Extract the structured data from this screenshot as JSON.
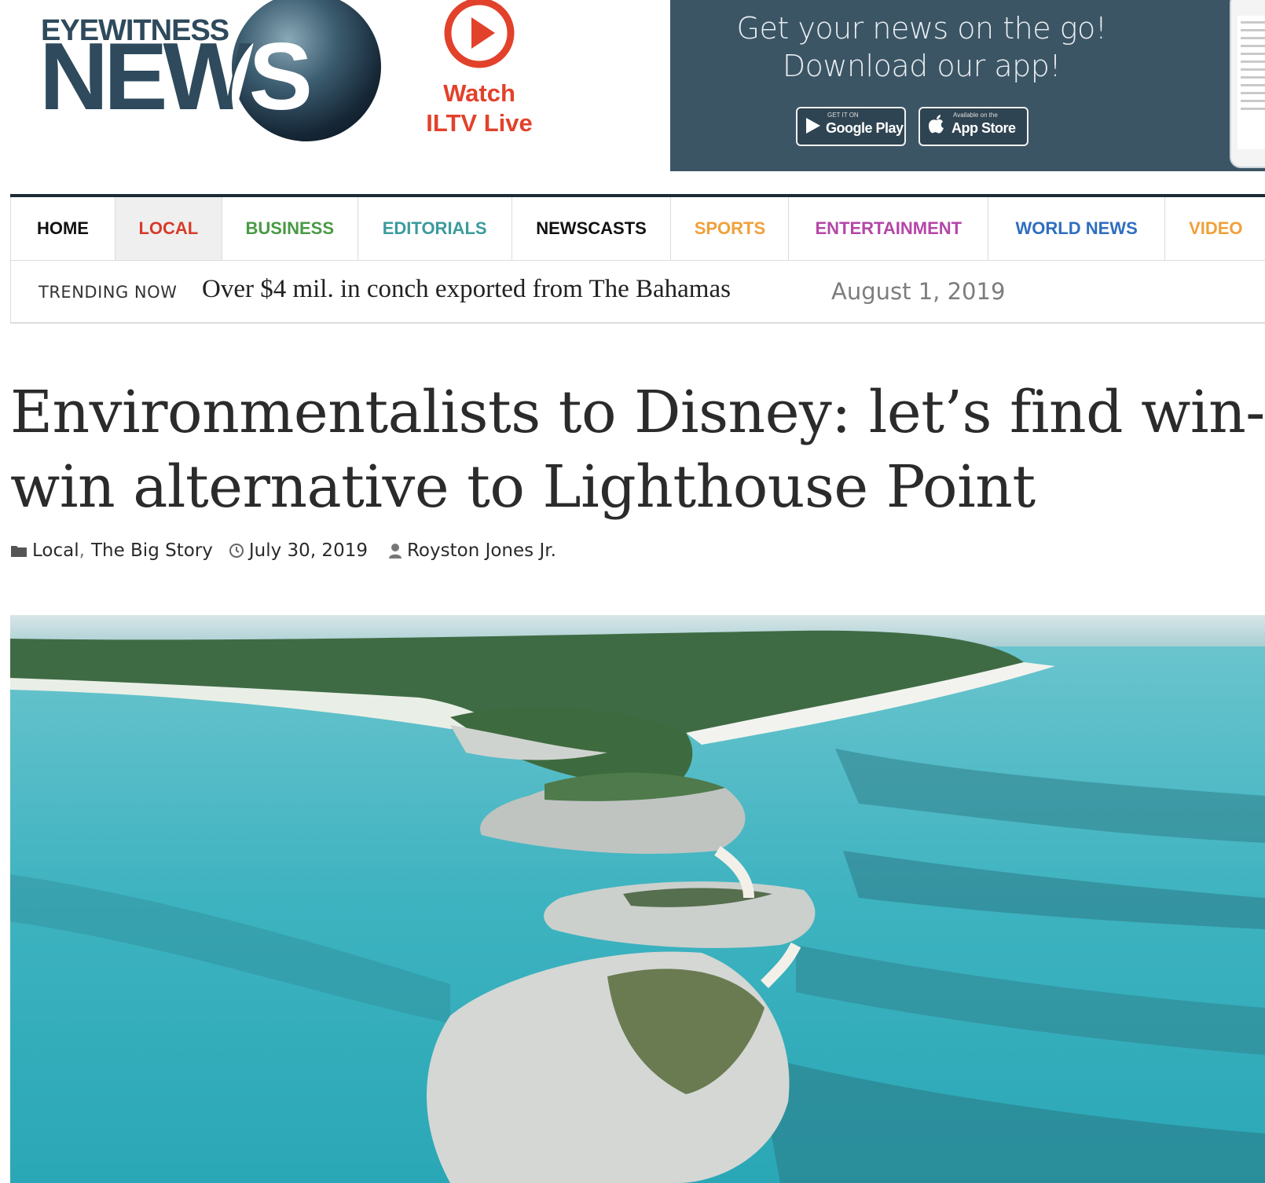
{
  "logo": {
    "top_text": "EYEWITNESS",
    "main_text": "NEWS"
  },
  "watch": {
    "label": "Watch\nILTV Live",
    "color": "#e2412b"
  },
  "ad": {
    "line1": "Get your news on the go!",
    "line2": "Download our app!",
    "google_play": {
      "small": "GET IT ON",
      "name": "Google Play"
    },
    "app_store": {
      "small": "Available on the",
      "name": "App Store"
    }
  },
  "nav": {
    "items": [
      {
        "label": "HOME",
        "color": "#111111",
        "active": false
      },
      {
        "label": "LOCAL",
        "color": "#d63b2a",
        "active": true
      },
      {
        "label": "BUSINESS",
        "color": "#4a9a45",
        "active": false
      },
      {
        "label": "EDITORIALS",
        "color": "#3b9b9c",
        "active": false
      },
      {
        "label": "NEWSCASTS",
        "color": "#111111",
        "active": false
      },
      {
        "label": "SPORTS",
        "color": "#f0a03a",
        "active": false
      },
      {
        "label": "ENTERTAINMENT",
        "color": "#b546a8",
        "active": false
      },
      {
        "label": "WORLD NEWS",
        "color": "#2f6ec0",
        "active": false
      },
      {
        "label": "VIDEO",
        "color": "#f0a03a",
        "active": false
      }
    ]
  },
  "trending": {
    "label": "TRENDING NOW",
    "headline": "Over $4 mil. in conch exported from The Bahamas",
    "date": "August 1, 2019"
  },
  "article": {
    "title": "Environmentalists to Disney: let’s find win-win alternative to Lighthouse Point",
    "categories": [
      "Local",
      "The Big Story"
    ],
    "category_separator": ",",
    "date": "July 30, 2019",
    "author": "Royston Jones Jr."
  },
  "icons": {
    "folder": "folder-icon",
    "clock": "clock-icon",
    "user": "user-icon",
    "play": "play-icon",
    "apple": "apple-icon",
    "google_play": "google-play-icon"
  }
}
